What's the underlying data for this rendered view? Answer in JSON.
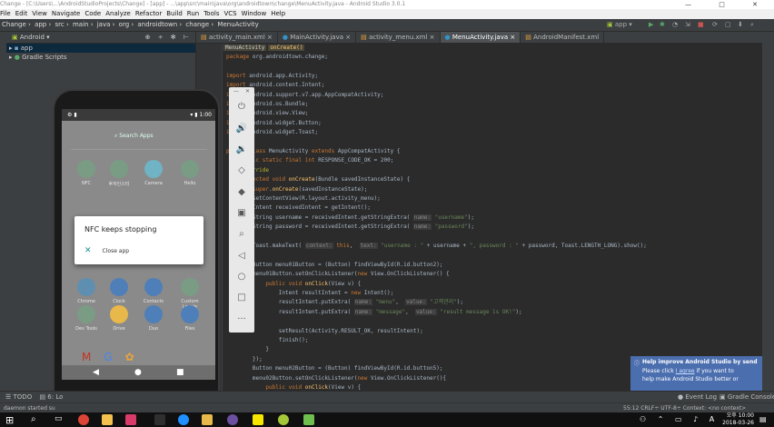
{
  "titlebar": {
    "text": "Change - [C:\\Users\\...\\AndroidStudioProjects\\Change] - [app] - ...\\app\\src\\main\\java\\org\\androidtown\\change\\MenuActivity.java - Android Studio 3.0.1"
  },
  "menu": [
    "File",
    "Edit",
    "View",
    "Navigate",
    "Code",
    "Analyze",
    "Refactor",
    "Build",
    "Run",
    "Tools",
    "VCS",
    "Window",
    "Help"
  ],
  "nav": {
    "crumbs": [
      "Change",
      "app",
      "src",
      "main",
      "java",
      "org",
      "androidtown",
      "change",
      "MenuActivity"
    ],
    "run_config": "app"
  },
  "project": {
    "view_mode": "Android",
    "items": [
      {
        "label": "app",
        "selected": true
      },
      {
        "label": "Gradle Scripts",
        "selected": false
      }
    ]
  },
  "tabs": [
    {
      "label": "activity_main.xml",
      "active": false
    },
    {
      "label": "MainActivity.java",
      "active": false
    },
    {
      "label": "activity_menu.xml",
      "active": false
    },
    {
      "label": "MenuActivity.java",
      "active": true
    },
    {
      "label": "AndroidManifest.xml",
      "active": false
    }
  ],
  "editor": {
    "breadcrumbs": [
      "MenuActivity",
      "onCreate()"
    ],
    "lines": [
      "package org.androidtown.change;",
      "",
      "import android.app.Activity;",
      "import android.content.Intent;",
      "import android.support.v7.app.AppCompatActivity;",
      "import android.os.Bundle;",
      "import android.view.View;",
      "import android.widget.Button;",
      "import android.widget.Toast;",
      "",
      "public class MenuActivity extends AppCompatActivity {",
      "    public static final int RESPONSE_CODE_OK = 200;",
      "    @Override",
      "    protected void onCreate(Bundle savedInstanceState) {",
      "        super.onCreate(savedInstanceState);",
      "        setContentView(R.layout.activity_menu);",
      "        Intent receivedIntent = getIntent();",
      "        String username = receivedIntent.getStringExtra( name: \"username\");",
      "        String password = receivedIntent.getStringExtra( name: \"password\");",
      "",
      "        Toast.makeText( context: this,  text: \"username : \" + username + \", password : \" + password, Toast.LENGTH_LONG).show();",
      "",
      "        Button menu01Button = (Button) findViewById(R.id.button2);",
      "        menu01Button.setOnClickListener(new View.OnClickListener() {",
      "            public void onClick(View v) {",
      "                Intent resultIntent = new Intent();",
      "                resultIntent.putExtra( name: \"menu\",  value: \"고객관리\");",
      "                resultIntent.putExtra( name: \"message\",  value: \"result message is OK!\");",
      "",
      "                setResult(Activity.RESULT_OK, resultIntent);",
      "                finish();",
      "            }",
      "        });",
      "        Button menu02Button = (Button) findViewById(R.id.button5);",
      "        menu02Button.setOnClickListener(new View.OnClickListener(){",
      "            public void onClick(View v) {"
    ]
  },
  "emulator": {
    "status_time": "1:00",
    "search_label": "Search Apps",
    "apps_row1": [
      {
        "label": "NFC",
        "color": "#7a9c84"
      },
      {
        "label": "후자인스터",
        "color": "#7a9c84"
      },
      {
        "label": "Camera",
        "color": "#6fb3c4"
      },
      {
        "label": "Hello",
        "color": "#7a9c84"
      }
    ],
    "apps_row2": [
      {
        "label": "Chrome",
        "color": "#5f8fb0"
      },
      {
        "label": "Clock",
        "color": "#4f7fb8"
      },
      {
        "label": "Contacts",
        "color": "#4f7fb8"
      },
      {
        "label": "Custom Locale",
        "color": "#7a9c84"
      }
    ],
    "apps_row3": [
      {
        "label": "Dev Tools",
        "color": "#7a9c84"
      },
      {
        "label": "Drive",
        "color": "#e8b84a"
      },
      {
        "label": "Duo",
        "color": "#4f7fb8"
      },
      {
        "label": "Files",
        "color": "#4f7fb8"
      }
    ],
    "dialog": {
      "title": "NFC keeps stopping",
      "action": "Close app"
    }
  },
  "emulator_toolbar": [
    "power-icon",
    "volume-up-icon",
    "volume-down-icon",
    "rotate-left-icon",
    "rotate-right-icon",
    "camera-icon",
    "zoom-icon",
    "back-icon",
    "home-icon",
    "overview-icon",
    "more-icon"
  ],
  "bottom_tabs": [
    "TODO",
    "6: Lo"
  ],
  "bottom_right": {
    "event_log": "Event Log",
    "gradle_console": "Gradle Console"
  },
  "status": {
    "left": "daemon started su",
    "right": "55:12  CRLF÷  UTF-8÷  Context: <no context>"
  },
  "notification": {
    "title": "Help improve Android Studio by send",
    "line1_pre": "Please click ",
    "line1_link": "I agree",
    "line1_post": " if you want to",
    "line2": "help make Android Studio better or "
  },
  "taskbar": {
    "time": "오후 10:00",
    "date": "2018-03-26"
  },
  "colors": {
    "accent": "#4b6eaf",
    "editor_bg": "#2b2b2b",
    "panel_bg": "#3c3f41"
  }
}
